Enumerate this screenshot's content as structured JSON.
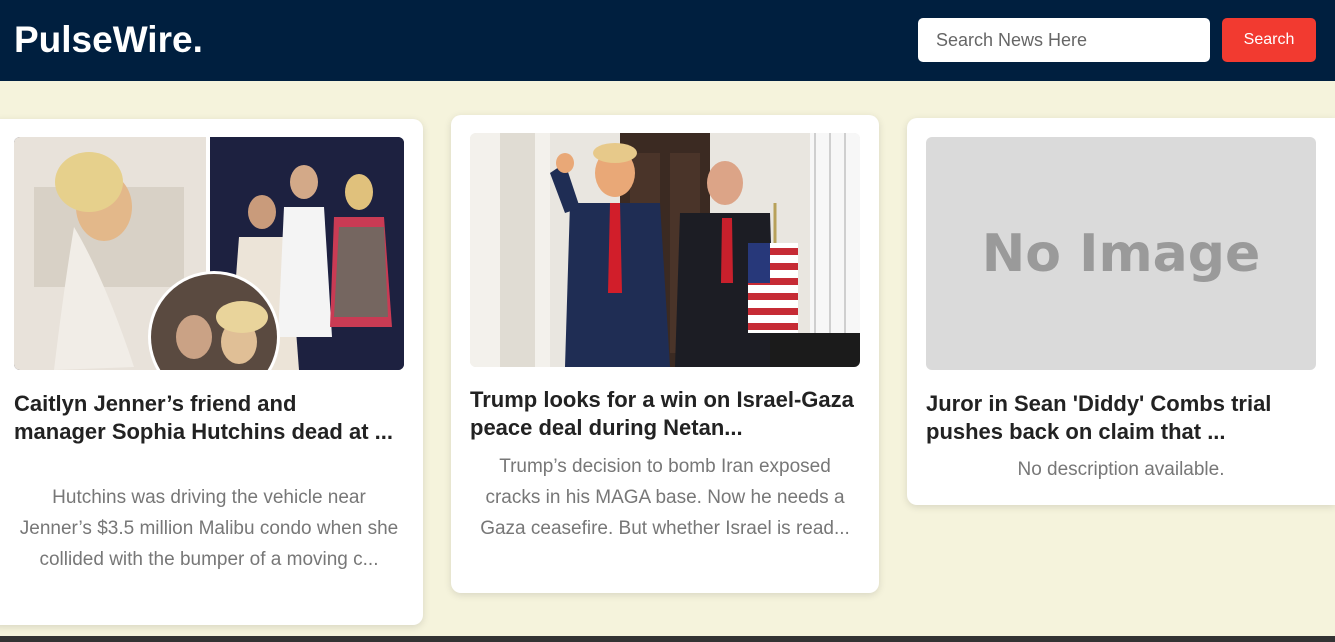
{
  "header": {
    "brand": "PulseWire.",
    "search_placeholder": "Search News Here",
    "search_button": "Search"
  },
  "articles": [
    {
      "title": "Caitlyn Jenner’s friend and manager Sophia Hutchins dead at ...",
      "description": "Hutchins was driving the vehicle near Jenner’s $3.5 million Malibu condo when she collided with the bumper of a moving c..."
    },
    {
      "title": "Trump looks for a win on Israel-Gaza peace deal during Netan...",
      "description": "Trump’s decision to bomb Iran exposed cracks in his MAGA base. Now he needs a Gaza ceasefire. But whether Israel is read..."
    },
    {
      "title": "Juror in Sean 'Diddy' Combs trial pushes back on claim that ...",
      "image_placeholder": "No Image",
      "description": "No description available."
    }
  ],
  "colors": {
    "navbar": "#001f3f",
    "background": "#f5f3dc",
    "accent": "#f23a30"
  }
}
